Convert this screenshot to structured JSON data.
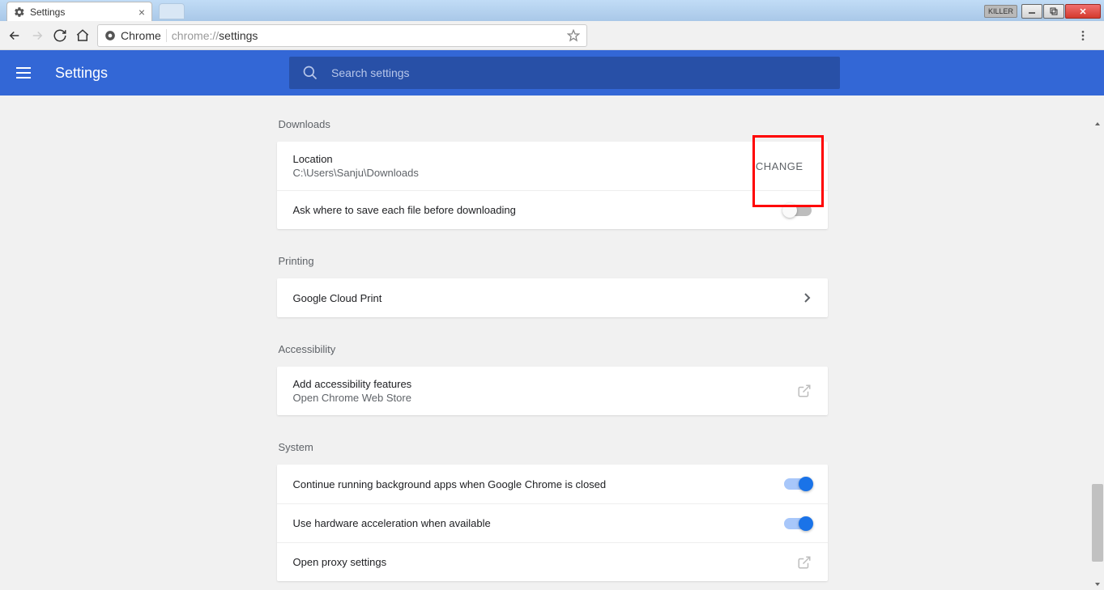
{
  "window": {
    "killer_badge": "KILLER",
    "tab": {
      "title": "Settings"
    }
  },
  "browser": {
    "origin_label": "Chrome",
    "url_prefix": "chrome://",
    "url_path": "settings"
  },
  "header": {
    "title": "Settings",
    "search_placeholder": "Search settings"
  },
  "sections": {
    "downloads": {
      "title": "Downloads",
      "location_label": "Location",
      "location_value": "C:\\Users\\Sanju\\Downloads",
      "change_label": "CHANGE",
      "ask_label": "Ask where to save each file before downloading",
      "ask_on": false
    },
    "printing": {
      "title": "Printing",
      "cloud_print_label": "Google Cloud Print"
    },
    "accessibility": {
      "title": "Accessibility",
      "add_label": "Add accessibility features",
      "add_sub": "Open Chrome Web Store"
    },
    "system": {
      "title": "System",
      "bg_apps_label": "Continue running background apps when Google Chrome is closed",
      "bg_apps_on": true,
      "hw_accel_label": "Use hardware acceleration when available",
      "hw_accel_on": true,
      "proxy_label": "Open proxy settings"
    }
  }
}
